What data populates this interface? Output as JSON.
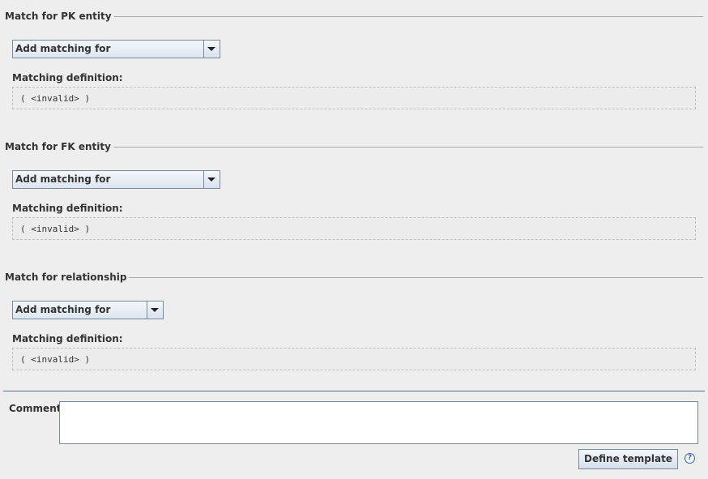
{
  "sections": [
    {
      "title": "Match for PK entity",
      "combo_value": "Add matching for",
      "definition_label": "Matching definition:",
      "definition_value": "( <invalid> )"
    },
    {
      "title": "Match for FK entity",
      "combo_value": "Add matching for",
      "definition_label": "Matching definition:",
      "definition_value": "( <invalid> )"
    },
    {
      "title": "Match for relationship",
      "combo_value": "Add matching for",
      "definition_label": "Matching definition:",
      "definition_value": "( <invalid> )"
    }
  ],
  "comment": {
    "label": "Comment:",
    "value": ""
  },
  "define_button_label": "Define template",
  "help_icon_glyph": "?",
  "colors": {
    "background": "#eeeeee",
    "divider": "#5a6f8f",
    "help_icon": "#3a66b5"
  }
}
